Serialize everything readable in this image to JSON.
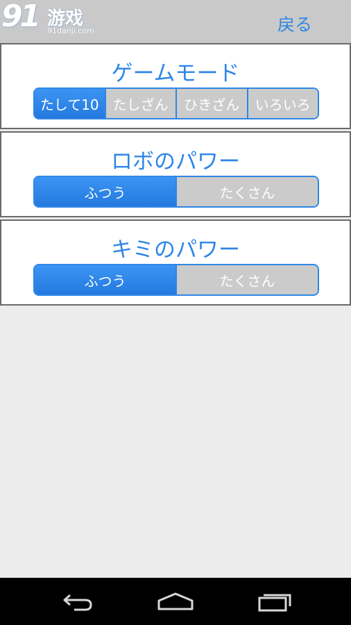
{
  "header": {
    "watermark": {
      "number": "91",
      "name": "游戏",
      "url": "91danji.com"
    },
    "back_label": "戻る"
  },
  "sections": [
    {
      "title": "ゲームモード",
      "options": [
        "たして10",
        "たしざん",
        "ひきざん",
        "いろいろ"
      ],
      "selected": "たして10"
    },
    {
      "title": "ロボのパワー",
      "options": [
        "ふつう",
        "たくさん"
      ],
      "selected": "ふつう"
    },
    {
      "title": "キミのパワー",
      "options": [
        "ふつう",
        "たくさん"
      ],
      "selected": "ふつう"
    }
  ],
  "navbar": {
    "icons": [
      "back-icon",
      "home-icon",
      "recent-apps-icon"
    ]
  },
  "colors": {
    "accent": "#2e86e6",
    "header_bg": "#c9c9c9",
    "page_bg": "#ececec",
    "unselected": "#cbcbcb",
    "navbar_bg": "#000000"
  }
}
